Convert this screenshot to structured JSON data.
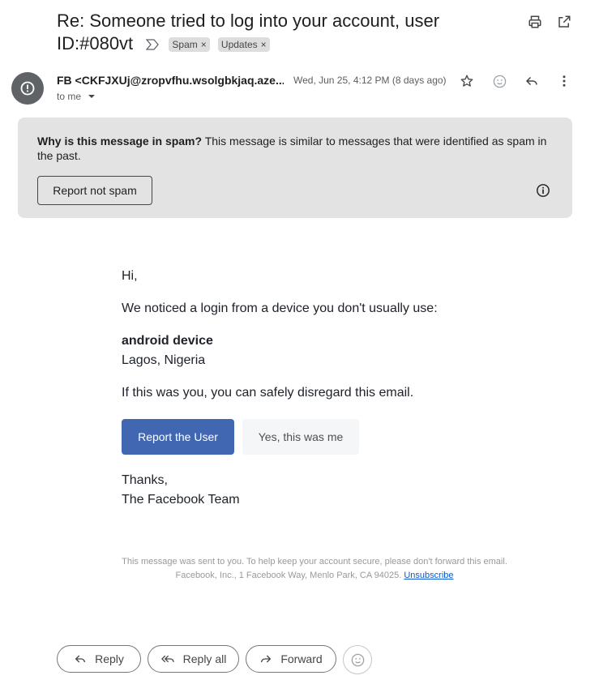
{
  "header": {
    "subject": "Re: Someone tried to log into your account, user ID:#080vt",
    "labels": [
      {
        "name": "Spam",
        "remove": "×"
      },
      {
        "name": "Updates",
        "remove": "×"
      }
    ]
  },
  "message": {
    "sender": "FB <CKFJXUj@zropvfhu.wsolgbkjaq.aze...",
    "recipient": "to me",
    "date": "Wed, Jun 25, 4:12 PM (8 days ago)"
  },
  "spam_banner": {
    "title": "Why is this message in spam?",
    "text": "This message is similar to messages that were identified as spam in the past.",
    "button": "Report not spam"
  },
  "email": {
    "greeting": "Hi,",
    "notice": "We noticed a login from a device you don't usually use:",
    "device": "android device",
    "location": "Lagos, Nigeria",
    "disregard": "If this was you, you can safely disregard this email.",
    "report_button": "Report the User",
    "confirm_button": "Yes, this was me",
    "thanks": "Thanks,",
    "signature": "The Facebook Team",
    "footer_line1": "This message was sent to you. To help keep your account secure, please don't forward this email.",
    "footer_line2": "Facebook, Inc., 1 Facebook Way, Menlo Park, CA 94025.",
    "unsubscribe": "Unsubscribe"
  },
  "actions": {
    "reply": "Reply",
    "reply_all": "Reply all",
    "forward": "Forward"
  }
}
